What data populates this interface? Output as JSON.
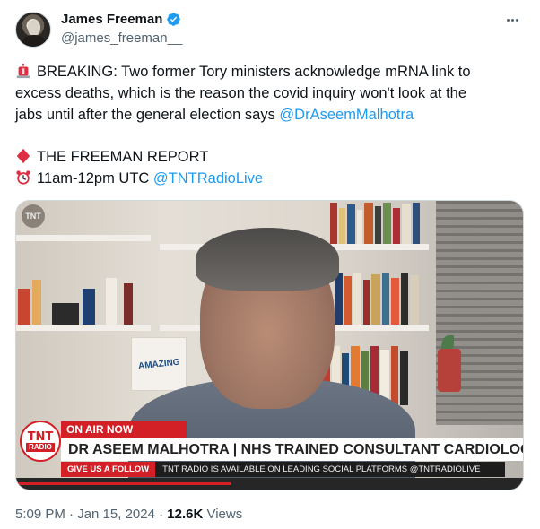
{
  "author": {
    "display_name": "James Freeman",
    "handle": "@james_freeman__"
  },
  "tweet": {
    "line1": "BREAKING: Two former Tory ministers acknowledge mRNA link to",
    "line2": "excess deaths, which is the reason the covid inquiry won't look at the",
    "line3": "jabs until after the general election says ",
    "mention1": "@DrAseemMalhotra",
    "show_title": "THE FREEMAN REPORT",
    "time_slot": "11am-12pm UTC ",
    "mention2": "@TNTRadioLive"
  },
  "media": {
    "book_text": "AMAZING",
    "logo_top": "TNT",
    "logo_bottom": "RADIO",
    "on_air": "ON AIR NOW",
    "headline": "DR ASEEM MALHOTRA | NHS TRAINED CONSULTANT CARDIOLOGIST",
    "ticker_label": "GIVE US A FOLLOW",
    "ticker_text": "TNT RADIO IS AVAILABLE ON LEADING SOCIAL PLATFORMS @TNTRADIOLIVE"
  },
  "meta": {
    "timestamp": "5:09 PM · Jan 15, 2024 · ",
    "views_count": "12.6K",
    "views_label": " Views"
  },
  "colors": {
    "link": "#1d9bf0",
    "verified": "#1d9bf0",
    "tnt_red": "#d31f26"
  },
  "icons": [
    "verified-badge-icon",
    "more-options-icon",
    "siren-icon",
    "diamond-icon",
    "alarm-clock-icon"
  ]
}
